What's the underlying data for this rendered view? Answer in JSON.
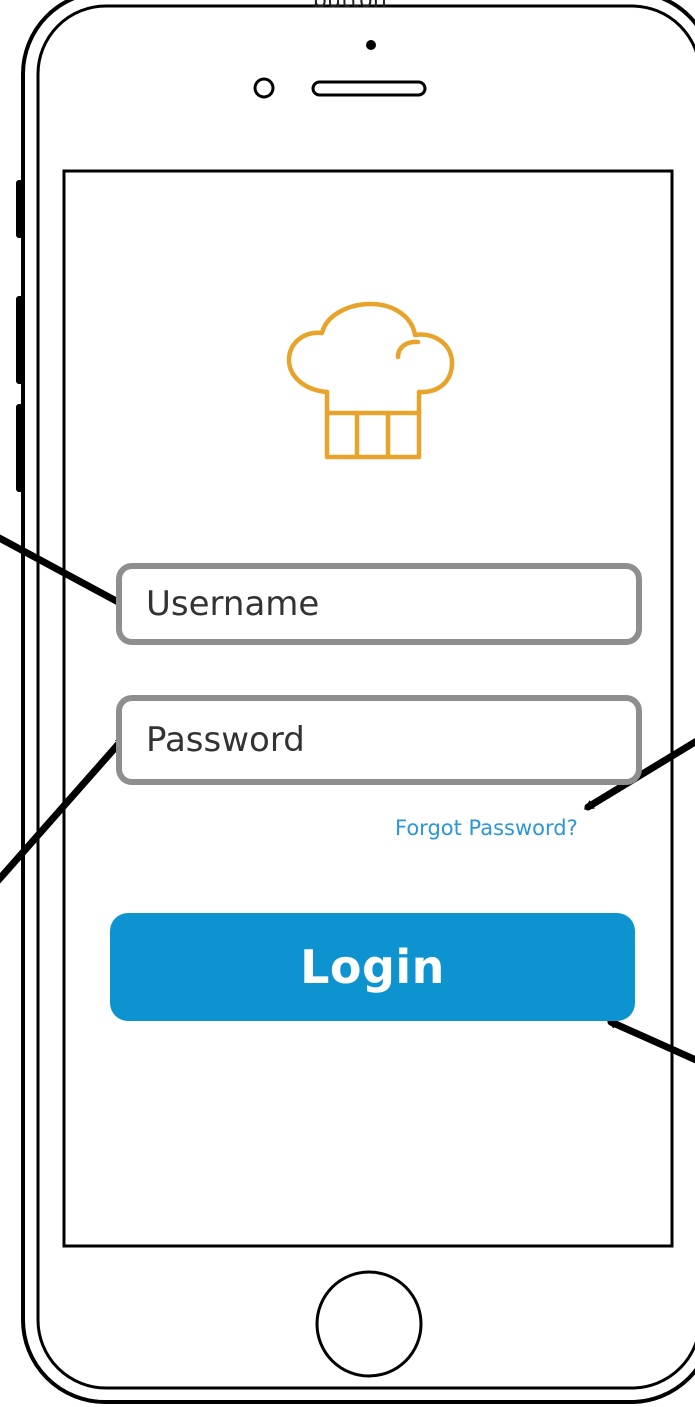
{
  "top_caption": "button",
  "app": {
    "logo_icon": "chef-hat-icon",
    "logo_color": "#E8A32A"
  },
  "form": {
    "username_placeholder": "Username",
    "password_placeholder": "Password",
    "forgot_password_label": "Forgot Password?",
    "login_label": "Login"
  },
  "colors": {
    "field_border": "#8E8E8E",
    "link": "#2B97D6",
    "login_button": "#0E93D1",
    "login_text": "#FFFFFF",
    "outline": "#000000"
  },
  "annotations": {
    "arrows": [
      "arrow-to-username",
      "arrow-to-password",
      "arrow-to-forgot-password",
      "arrow-to-login-button"
    ]
  }
}
